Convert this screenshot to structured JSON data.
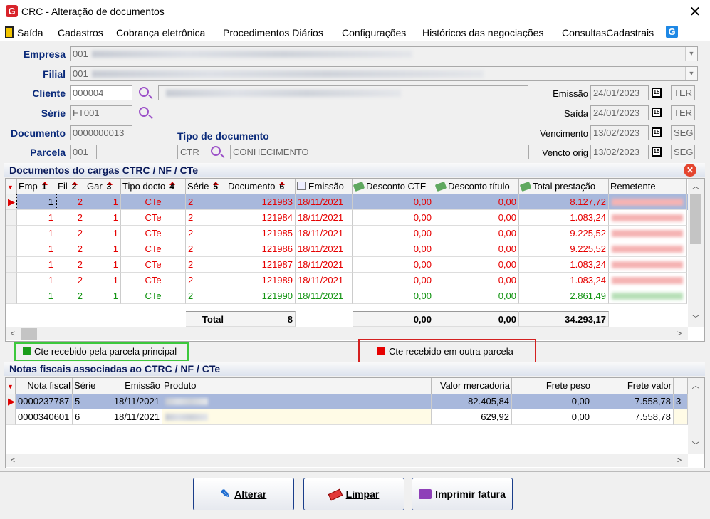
{
  "window": {
    "title": "CRC - Alteração de documentos",
    "app_icon": "G"
  },
  "menu": {
    "items": [
      "Saída",
      "Cadastros",
      "Cobrança eletrônica",
      "Procedimentos Diários",
      "Configurações",
      "Históricos das negociações",
      "ConsultasCadastrais"
    ],
    "help_icon": "G"
  },
  "form": {
    "empresa_label": "Empresa",
    "empresa_value": "001",
    "filial_label": "Filial",
    "filial_value": "001",
    "cliente_label": "Cliente",
    "cliente_value": "000004",
    "serie_label": "Série",
    "serie_value": "FT001",
    "documento_label": "Documento",
    "documento_value": "0000000013",
    "parcela_label": "Parcela",
    "parcela_value": "001",
    "tipo_label": "Tipo de documento",
    "tipo_code": "CTR",
    "tipo_desc": "CONHECIMENTO",
    "emissao_label": "Emissão",
    "emissao_date": "24/01/2023",
    "emissao_day": "TER",
    "saida_label": "Saída",
    "saida_date": "24/01/2023",
    "saida_day": "TER",
    "venc_label": "Vencimento",
    "venc_date": "13/02/2023",
    "venc_day": "SEG",
    "vencorig_label": "Vencto orig",
    "vencorig_date": "13/02/2023",
    "vencorig_day": "SEG",
    "cal_glyph": "15"
  },
  "docs": {
    "title": "Documentos do cargas CTRC / NF / CTe",
    "headers": [
      "Emp",
      "Fil",
      "Gar",
      "Tipo docto",
      "Série",
      "Documento",
      "Emissão",
      "Desconto CTE",
      "Desconto título",
      "Total prestação",
      "Remetente"
    ],
    "sort_nums": [
      "1",
      "2",
      "3",
      "4",
      "5",
      "6"
    ],
    "rows": [
      {
        "emp": "1",
        "fil": "2",
        "gar": "1",
        "tipo": "CTe",
        "serie": "2",
        "doc": "121983",
        "emissao": "18/11/2021",
        "dcte": "0,00",
        "dtit": "0,00",
        "total": "8.127,72",
        "color": "red"
      },
      {
        "emp": "1",
        "fil": "2",
        "gar": "1",
        "tipo": "CTe",
        "serie": "2",
        "doc": "121984",
        "emissao": "18/11/2021",
        "dcte": "0,00",
        "dtit": "0,00",
        "total": "1.083,24",
        "color": "red"
      },
      {
        "emp": "1",
        "fil": "2",
        "gar": "1",
        "tipo": "CTe",
        "serie": "2",
        "doc": "121985",
        "emissao": "18/11/2021",
        "dcte": "0,00",
        "dtit": "0,00",
        "total": "9.225,52",
        "color": "red"
      },
      {
        "emp": "1",
        "fil": "2",
        "gar": "1",
        "tipo": "CTe",
        "serie": "2",
        "doc": "121986",
        "emissao": "18/11/2021",
        "dcte": "0,00",
        "dtit": "0,00",
        "total": "9.225,52",
        "color": "red"
      },
      {
        "emp": "1",
        "fil": "2",
        "gar": "1",
        "tipo": "CTe",
        "serie": "2",
        "doc": "121987",
        "emissao": "18/11/2021",
        "dcte": "0,00",
        "dtit": "0,00",
        "total": "1.083,24",
        "color": "red"
      },
      {
        "emp": "1",
        "fil": "2",
        "gar": "1",
        "tipo": "CTe",
        "serie": "2",
        "doc": "121989",
        "emissao": "18/11/2021",
        "dcte": "0,00",
        "dtit": "0,00",
        "total": "1.083,24",
        "color": "red"
      },
      {
        "emp": "1",
        "fil": "2",
        "gar": "1",
        "tipo": "CTe",
        "serie": "2",
        "doc": "121990",
        "emissao": "18/11/2021",
        "dcte": "0,00",
        "dtit": "0,00",
        "total": "2.861,49",
        "color": "green"
      }
    ],
    "footer": {
      "label": "Total",
      "count": "8",
      "dcte": "0,00",
      "dtit": "0,00",
      "total": "34.293,17"
    }
  },
  "legend": {
    "green": "Cte recebido pela parcela principal",
    "red": "Cte recebido em outra parcela",
    "green_color": "#1a9c1a",
    "red_color": "#e60000"
  },
  "notas": {
    "title": "Notas fiscais associadas ao CTRC / NF / CTe",
    "headers": [
      "Nota fiscal",
      "Série",
      "Emissão",
      "Produto",
      "Valor mercadoria",
      "Frete peso",
      "Frete valor"
    ],
    "rows": [
      {
        "nota": "0000237787",
        "serie": "5",
        "emissao": "18/11/2021",
        "valor": "82.405,84",
        "peso": "0,00",
        "fvalor": "7.558,78",
        "extra": "3"
      },
      {
        "nota": "0000340601",
        "serie": "6",
        "emissao": "18/11/2021",
        "valor": "629,92",
        "peso": "0,00",
        "fvalor": "7.558,78",
        "extra": ""
      }
    ]
  },
  "buttons": {
    "alterar": "Alterar",
    "limpar": "Limpar",
    "imprimir": "Imprimir fatura"
  }
}
